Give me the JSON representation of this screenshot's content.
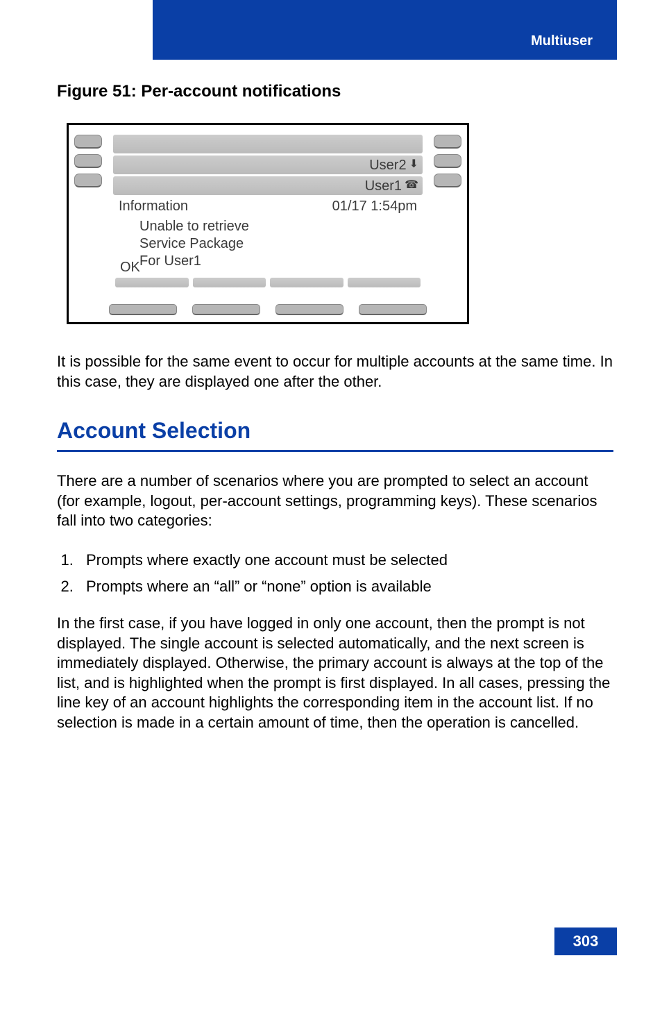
{
  "header": {
    "section": "Multiuser"
  },
  "figure": {
    "caption": "Figure 51: Per-account notifications",
    "line1": "",
    "line2": "User2",
    "line3": "User1",
    "info_label": "Information",
    "info_time": "01/17 1:54pm",
    "msg1": "Unable to retrieve",
    "msg2": "Service Package",
    "msg3": "For User1",
    "softkey_ok": "OK"
  },
  "body": {
    "para1": "It is possible for the same event to occur for multiple accounts at the same time. In this case, they are displayed one after the other.",
    "heading": "Account Selection",
    "para2": "There are a number of scenarios where you are prompted to select an account (for example, logout, per-account settings, programming keys). These scenarios fall into two categories:",
    "list": [
      "Prompts where exactly one account must be selected",
      "Prompts where an “all” or “none” option is available"
    ],
    "para3": "In the first case, if you have logged in only one account, then the prompt is not displayed. The single account is selected automatically, and the next screen is immediately displayed. Otherwise, the primary account is always at the top of the list, and is highlighted when the prompt is first displayed. In all cases, pressing the line key of an account highlights the corresponding item in the account list. If no selection is made in a certain amount of time, then the operation is cancelled."
  },
  "page_number": "303"
}
